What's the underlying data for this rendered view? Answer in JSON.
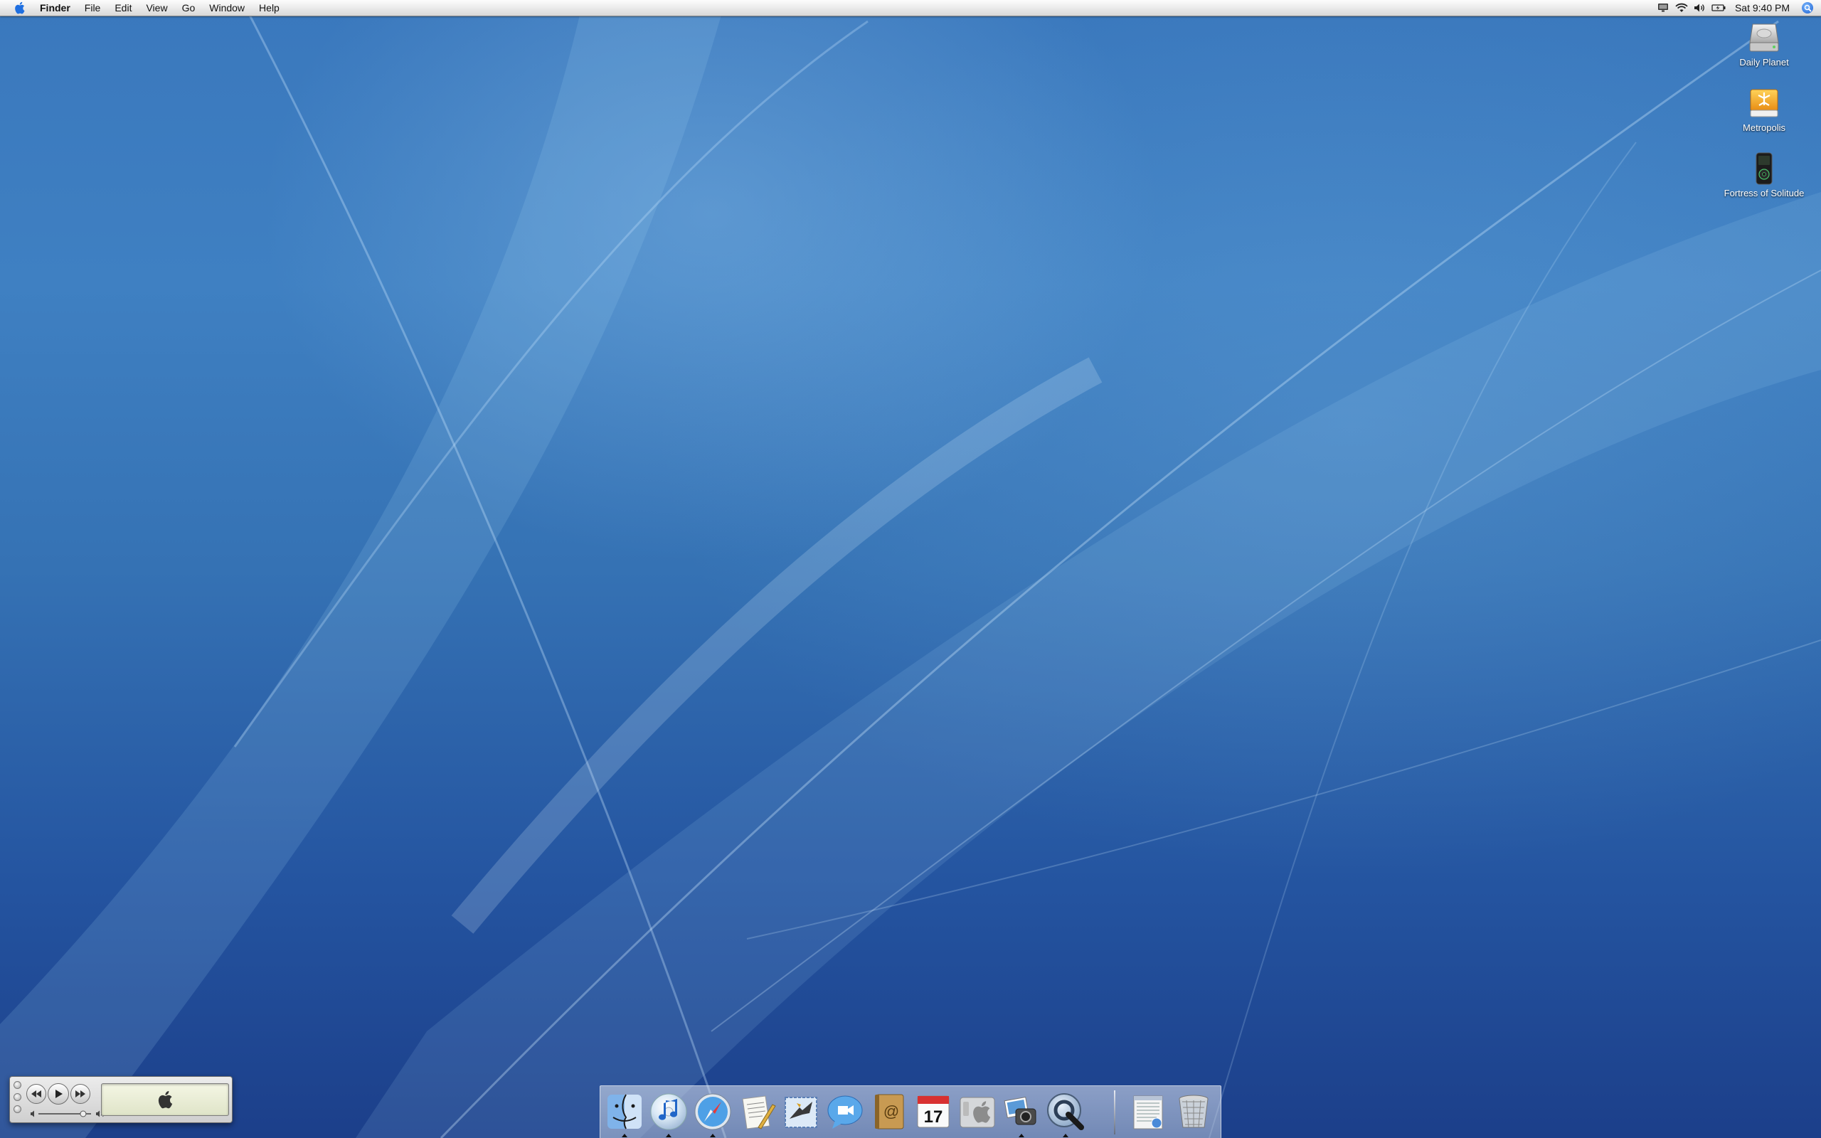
{
  "menubar": {
    "apple_menu_icon": "apple-icon",
    "app_name": "Finder",
    "menus": [
      "File",
      "Edit",
      "View",
      "Go",
      "Window",
      "Help"
    ],
    "status_icons": [
      "display-icon",
      "wifi-icon",
      "volume-icon",
      "battery-icon"
    ],
    "clock": "Sat 9:40 PM",
    "spotlight_icon": "spotlight-icon"
  },
  "desktop": {
    "icons": [
      {
        "label": "Daily Planet",
        "icon": "hard-drive-icon"
      },
      {
        "label": "Metropolis",
        "icon": "firewire-drive-icon"
      },
      {
        "label": "Fortress of Solitude",
        "icon": "ipod-icon"
      }
    ]
  },
  "mini_player": {
    "buttons": [
      "previous-icon",
      "play-icon",
      "next-icon"
    ],
    "display_icon": "apple-icon",
    "volume_level": 0.85
  },
  "dock": {
    "apps": [
      {
        "name": "Finder",
        "icon": "finder-icon",
        "running": true
      },
      {
        "name": "iTunes",
        "icon": "itunes-icon",
        "running": true
      },
      {
        "name": "Safari",
        "icon": "safari-icon",
        "running": true
      },
      {
        "name": "TextEdit",
        "icon": "textedit-icon",
        "running": false
      },
      {
        "name": "Mail",
        "icon": "mail-icon",
        "running": false
      },
      {
        "name": "iChat",
        "icon": "ichat-icon",
        "running": false
      },
      {
        "name": "Address Book",
        "icon": "address-book-icon",
        "running": false
      },
      {
        "name": "iCal",
        "icon": "ical-icon",
        "running": false,
        "badge": "17"
      },
      {
        "name": "System Preferences",
        "icon": "system-preferences-icon",
        "running": false
      },
      {
        "name": "iPhoto",
        "icon": "iphoto-icon",
        "running": true
      },
      {
        "name": "QuickTime Player",
        "icon": "quicktime-icon",
        "running": true
      }
    ],
    "documents": [
      {
        "name": "Documents",
        "icon": "documents-stack-icon"
      },
      {
        "name": "Trash",
        "icon": "trash-icon"
      }
    ]
  }
}
